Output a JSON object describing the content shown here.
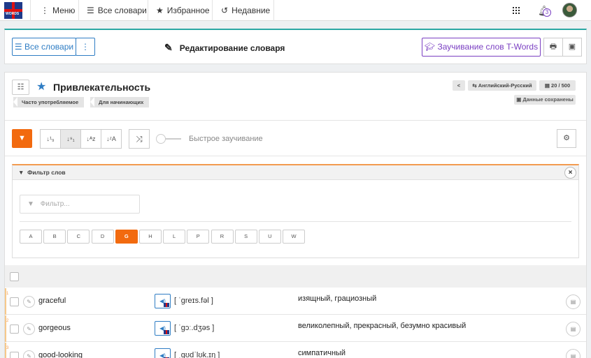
{
  "topnav": {
    "logo_text": "WORDS",
    "menu_label": "Меню",
    "all_dicts_label": "Все словари",
    "favorites_label": "Избранное",
    "recent_label": "Недавние",
    "notification_count": "3"
  },
  "toolbar": {
    "all_dicts_button": "Все словари",
    "page_title": "Редактирование словаря",
    "learn_button": "Заучивание слов T-Words"
  },
  "dictionary": {
    "title": "Привлекательность",
    "tags": [
      "Часто употребляемое",
      "Для начинающих"
    ],
    "language_pair": "Английский-Русский",
    "word_count": "20 / 500",
    "saved_status": "Данные сохранены"
  },
  "controls": {
    "quick_learn_label": "Быстрое заучивание",
    "quick_learn_on": false
  },
  "filter": {
    "header": "Фильтр слов",
    "placeholder": "Фильтр...",
    "letters": [
      "A",
      "B",
      "C",
      "D",
      "G",
      "H",
      "L",
      "P",
      "R",
      "S",
      "U",
      "W"
    ],
    "active_letter": "G"
  },
  "words": [
    {
      "num": "1",
      "word": "graceful",
      "transcription": "[ ˈɡreɪs.fəl ]",
      "meaning": "изящный, грациозный"
    },
    {
      "num": "2",
      "word": "gorgeous",
      "transcription": "[ ˈɡɔː.dʒəs ]",
      "meaning": "великолепный, прекрасный, безумно красивый"
    },
    {
      "num": "3",
      "word": "good-looking",
      "transcription": "[ ˌɡʊdˈlʊk.ɪŋ ]",
      "meaning": "симпатичный"
    }
  ],
  "colors": {
    "accent_orange": "#f26a0f",
    "accent_blue": "#2f7dc4",
    "accent_purple": "#7a3fc2",
    "teal_top": "#2ba7a3"
  }
}
